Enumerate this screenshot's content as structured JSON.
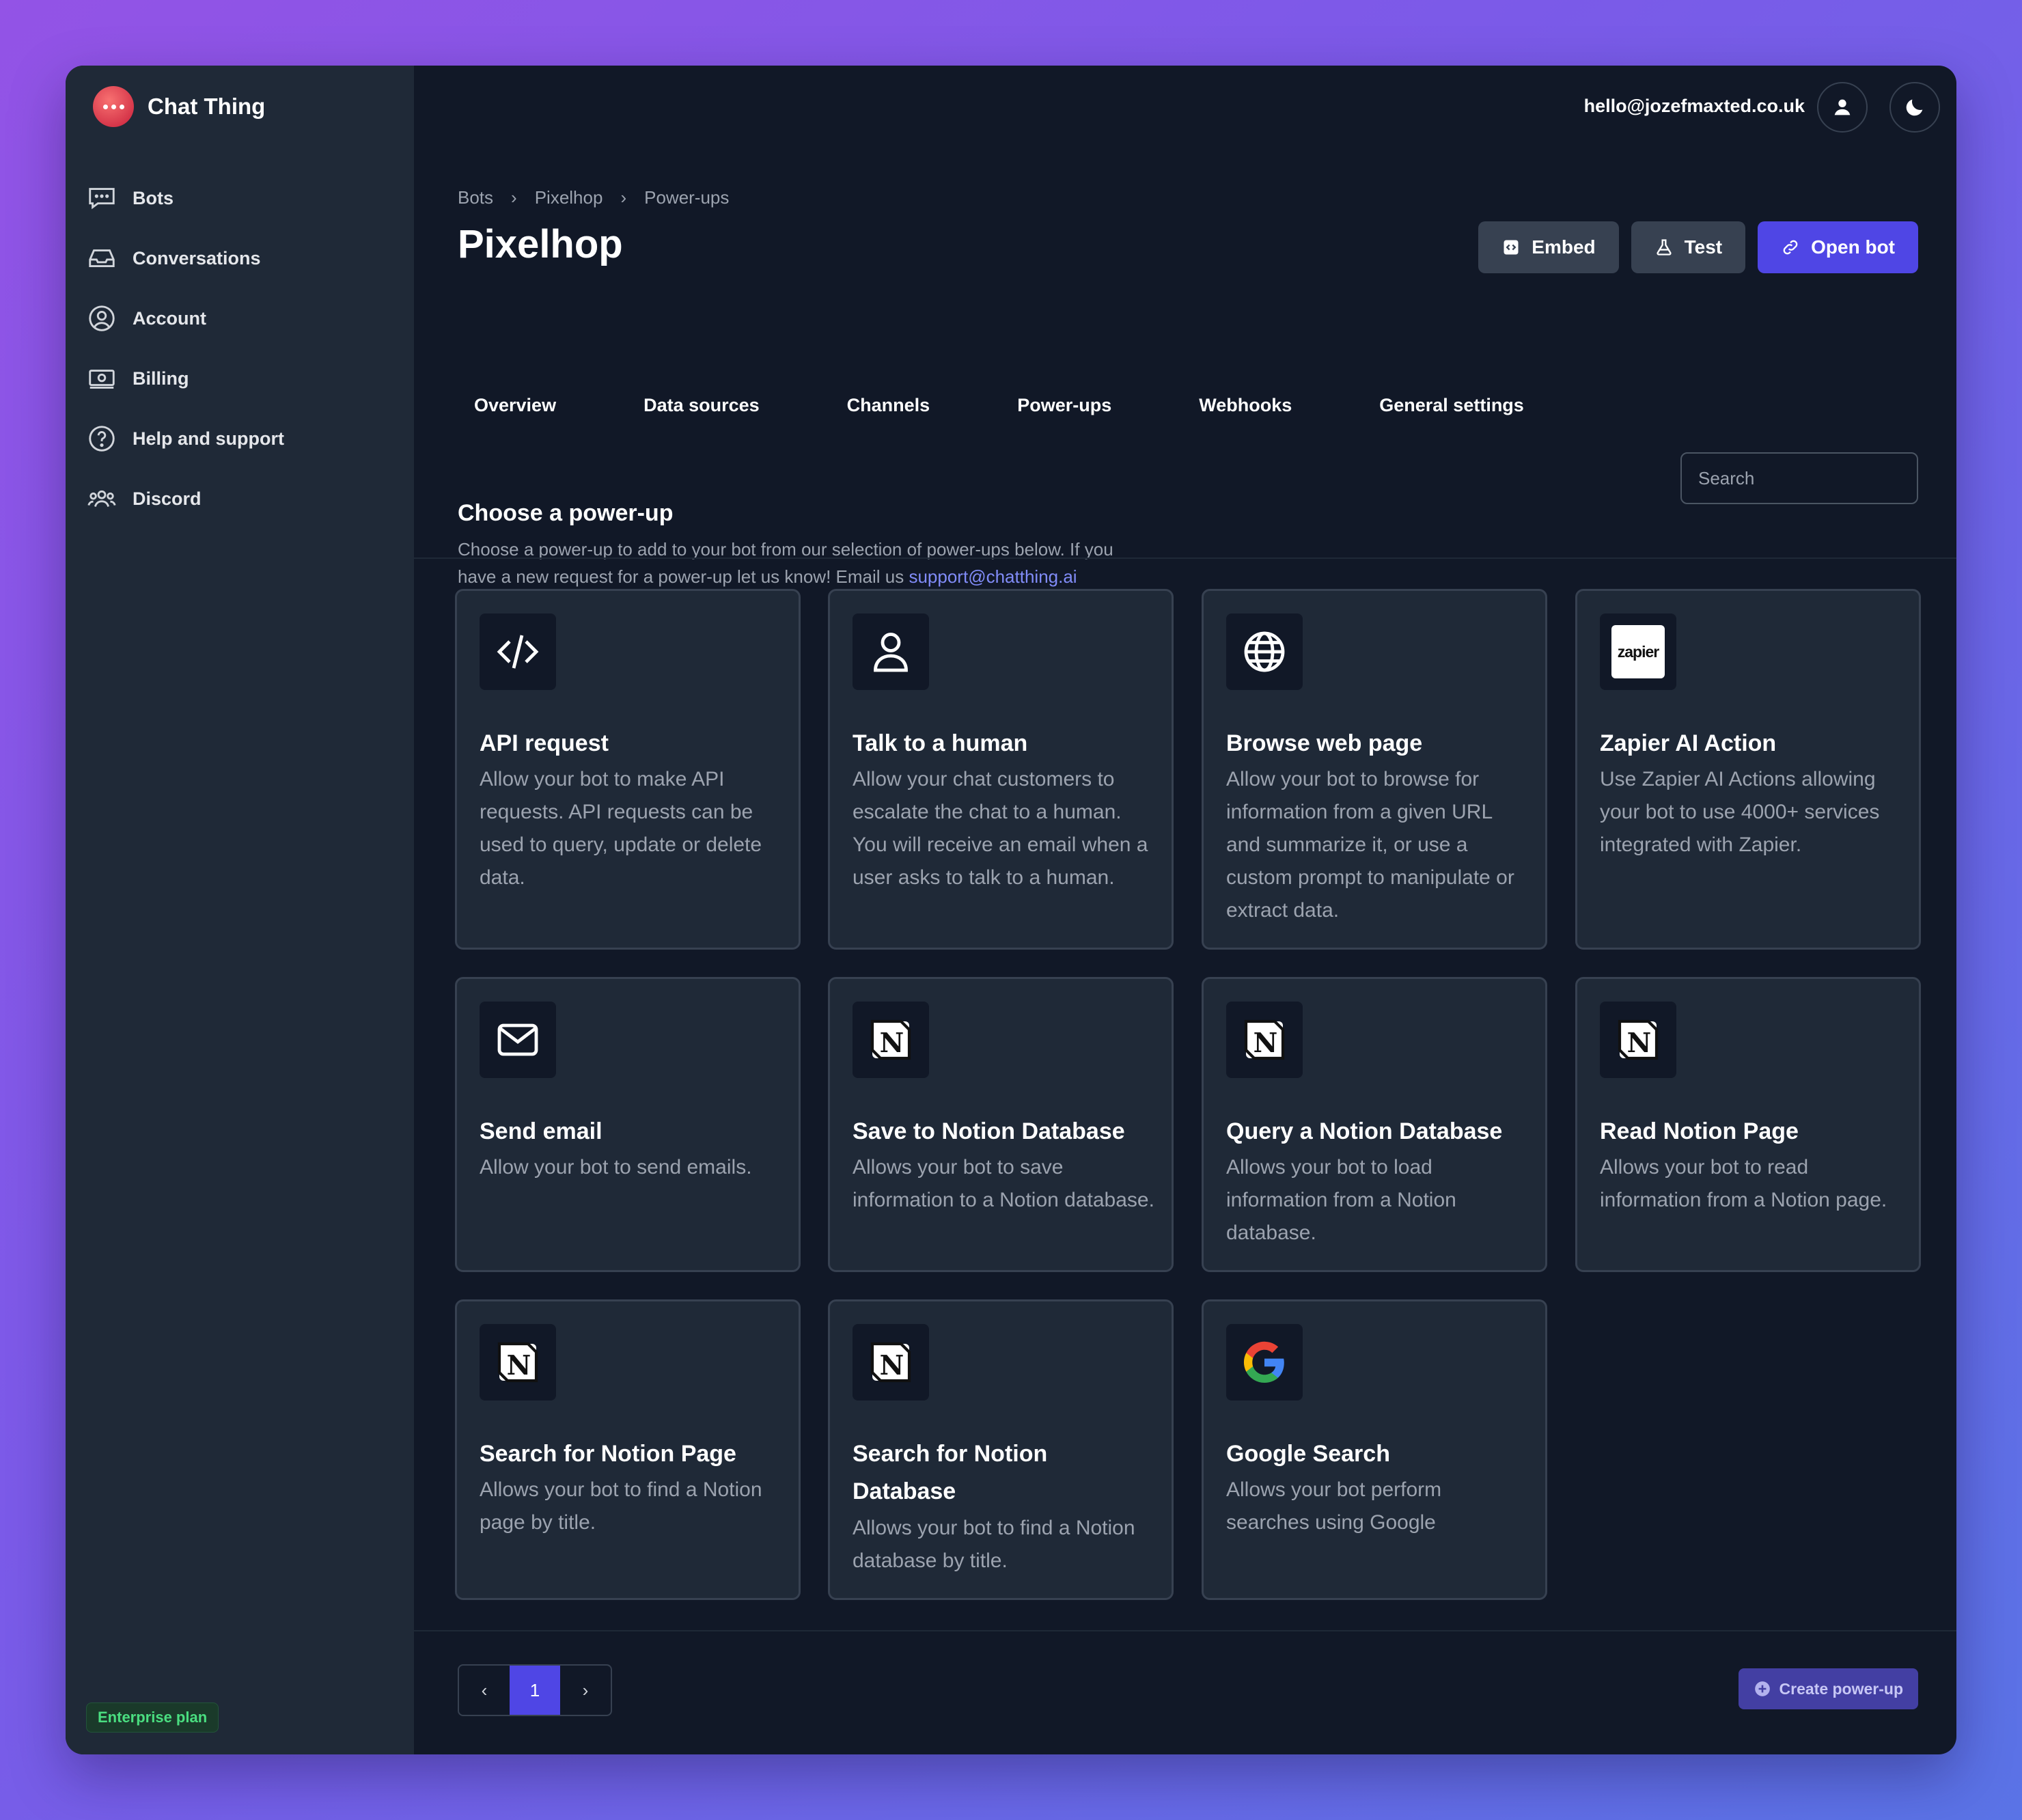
{
  "app": {
    "name": "Chat Thing",
    "user_email": "hello@jozefmaxted.co.uk",
    "plan_badge": "Enterprise plan"
  },
  "sidebar": {
    "items": [
      {
        "label": "Bots",
        "icon": "chat-bubble-icon"
      },
      {
        "label": "Conversations",
        "icon": "inbox-icon"
      },
      {
        "label": "Account",
        "icon": "user-circle-icon"
      },
      {
        "label": "Billing",
        "icon": "banknote-icon"
      },
      {
        "label": "Help and support",
        "icon": "question-circle-icon"
      },
      {
        "label": "Discord",
        "icon": "users-icon"
      }
    ]
  },
  "breadcrumb": [
    "Bots",
    "Pixelhop",
    "Power-ups"
  ],
  "page": {
    "title": "Pixelhop"
  },
  "actions": {
    "embed": "Embed",
    "test": "Test",
    "open_bot": "Open bot"
  },
  "tabs": [
    "Overview",
    "Data sources",
    "Channels",
    "Power-ups",
    "Webhooks",
    "General settings"
  ],
  "section": {
    "title": "Choose a power-up",
    "description": "Choose a power-up to add to your bot from our selection of power-ups below. If you have a new request for a power-up let us know! Email us",
    "email": "support@chatthing.ai"
  },
  "search": {
    "placeholder": "Search"
  },
  "powerups": [
    {
      "title": "API request",
      "description": "Allow your bot to make API requests. API requests can be used to query, update or delete data.",
      "icon": "code-icon"
    },
    {
      "title": "Talk to a human",
      "description": "Allow your chat customers to escalate the chat to a human. You will receive an email when a user asks to talk to a human.",
      "icon": "person-icon"
    },
    {
      "title": "Browse web page",
      "description": "Allow your bot to browse for information from a given URL and summarize it, or use a custom prompt to manipulate or extract data.",
      "icon": "globe-icon"
    },
    {
      "title": "Zapier AI Action",
      "description": "Use Zapier AI Actions allowing your bot to use 4000+ services integrated with Zapier.",
      "icon": "zapier-logo-icon",
      "logo_text": "zapier"
    },
    {
      "title": "Send email",
      "description": "Allow your bot to send emails.",
      "icon": "envelope-icon"
    },
    {
      "title": "Save to Notion Database",
      "description": "Allows your bot to save information to a Notion database.",
      "icon": "notion-logo-icon"
    },
    {
      "title": "Query a Notion Database",
      "description": "Allows your bot to load information from a Notion database.",
      "icon": "notion-logo-icon"
    },
    {
      "title": "Read Notion Page",
      "description": "Allows your bot to read information from a Notion page.",
      "icon": "notion-logo-icon"
    },
    {
      "title": "Search for Notion Page",
      "description": "Allows your bot to find a Notion page by title.",
      "icon": "notion-logo-icon"
    },
    {
      "title": "Search for Notion Database",
      "description": "Allows your bot to find a Notion database by title.",
      "icon": "notion-logo-icon"
    },
    {
      "title": "Google Search",
      "description": "Allows your bot perform searches using Google",
      "icon": "google-logo-icon"
    }
  ],
  "pagination": {
    "current_page": "1"
  },
  "create_button": "Create power-up",
  "colors": {
    "accent": "#4f46e5",
    "background": "#111827",
    "sidebar": "#1f2937",
    "card_border": "#374151"
  }
}
